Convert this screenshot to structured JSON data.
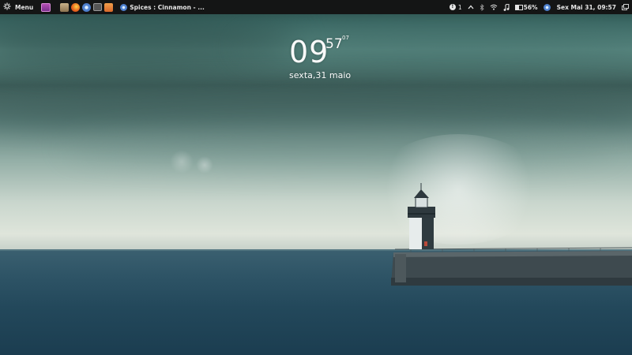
{
  "panel": {
    "menu_label": "Menu",
    "launchers": [
      {
        "icon": "terminal-app-icon"
      },
      {
        "icon": "files-app-icon"
      },
      {
        "icon": "firefox-icon"
      },
      {
        "icon": "chromium-icon"
      },
      {
        "icon": "screen-icon"
      },
      {
        "icon": "folder-icon"
      }
    ],
    "window_list": [
      {
        "title": "Spices : Cinnamon - ...",
        "icon": "browser-icon"
      }
    ],
    "tray": {
      "notification_count": "1",
      "battery_percent": "56%",
      "clock": "Sex Mai 31, 09:57"
    }
  },
  "desklet": {
    "hours": "09",
    "minutes": "57",
    "seconds": "07",
    "date": "sexta,31 maio"
  },
  "colors": {
    "panel_bg": "#141515",
    "sea": "#23485b",
    "sky_top": "#3a6763",
    "sky_horizon": "#dfe5db"
  }
}
